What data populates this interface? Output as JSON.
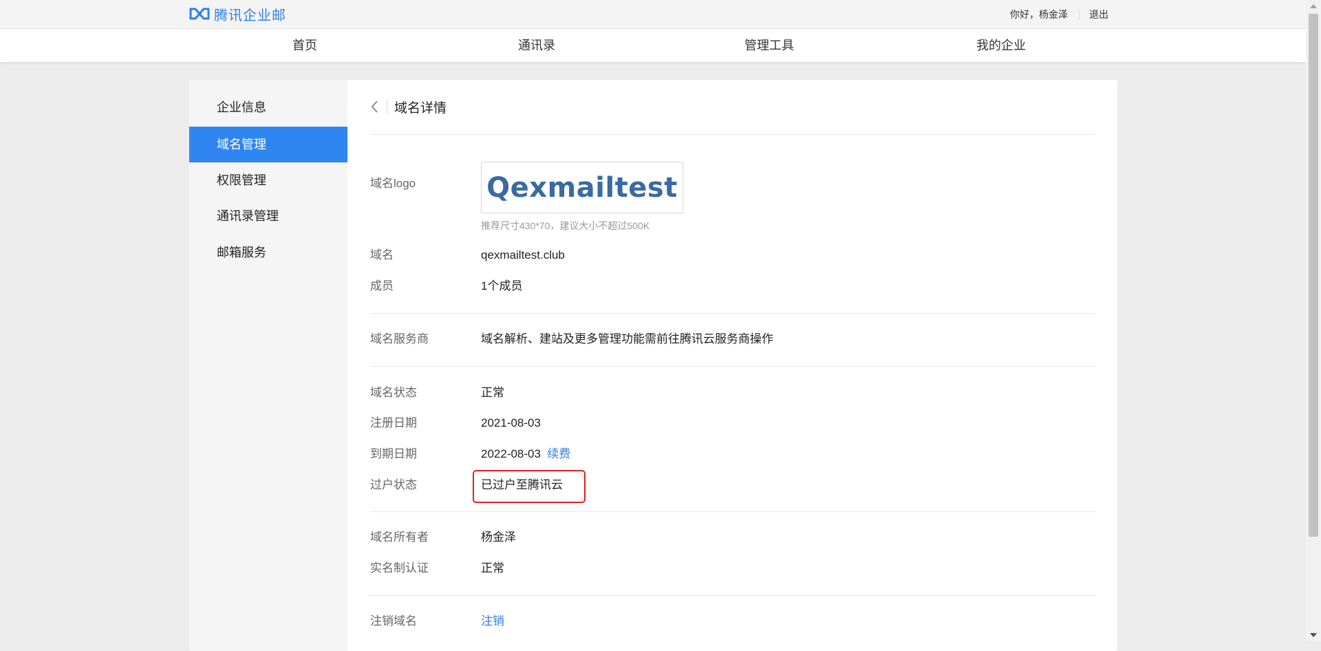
{
  "header": {
    "brand_name": "腾讯企业邮",
    "brand_icon": "tencent-exmail-logo",
    "greeting": "你好，杨金泽",
    "logout_label": "退出"
  },
  "nav": {
    "items": [
      {
        "label": "首页"
      },
      {
        "label": "通讯录"
      },
      {
        "label": "管理工具"
      },
      {
        "label": "我的企业"
      }
    ]
  },
  "sidebar": {
    "items": [
      {
        "label": "企业信息"
      },
      {
        "label": "域名管理",
        "active": true
      },
      {
        "label": "权限管理"
      },
      {
        "label": "通讯录管理"
      },
      {
        "label": "邮箱服务"
      }
    ]
  },
  "detail": {
    "title": "域名详情",
    "logo_label": "域名logo",
    "logo_text": "Qexmailtest",
    "logo_hint": "推荐尺寸430*70，建议大小不超过500K",
    "domain_label": "域名",
    "domain_value": "qexmailtest.club",
    "members_label": "成员",
    "members_value": "1个成员",
    "provider_label": "域名服务商",
    "provider_value": "域名解析、建站及更多管理功能需前往腾讯云服务商操作",
    "status_label": "域名状态",
    "status_value": "正常",
    "reg_date_label": "注册日期",
    "reg_date_value": "2021-08-03",
    "expire_date_label": "到期日期",
    "expire_date_value": "2022-08-03",
    "renew_label": "续费",
    "transfer_label": "过户状态",
    "transfer_value": "已过户至腾讯云",
    "owner_label": "域名所有者",
    "owner_value": "杨金泽",
    "realname_label": "实名制认证",
    "realname_value": "正常",
    "cancel_label": "注销域名",
    "cancel_link": "注销"
  },
  "colors": {
    "accent": "#2f86f0",
    "link": "#2f7fe6",
    "highlight": "#e21f1f"
  }
}
